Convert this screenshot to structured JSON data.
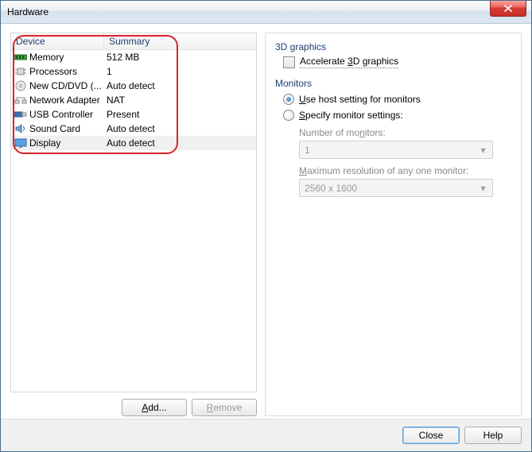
{
  "window": {
    "title": "Hardware"
  },
  "device_list": {
    "headers": {
      "device": "Device",
      "summary": "Summary"
    },
    "rows": [
      {
        "icon": "memory-icon",
        "name": "Memory",
        "summary": "512 MB",
        "selected": false
      },
      {
        "icon": "cpu-icon",
        "name": "Processors",
        "summary": "1",
        "selected": false
      },
      {
        "icon": "disc-icon",
        "name": "New CD/DVD (...",
        "summary": "Auto detect",
        "selected": false
      },
      {
        "icon": "network-icon",
        "name": "Network Adapter",
        "summary": "NAT",
        "selected": false
      },
      {
        "icon": "usb-icon",
        "name": "USB Controller",
        "summary": "Present",
        "selected": false
      },
      {
        "icon": "sound-icon",
        "name": "Sound Card",
        "summary": "Auto detect",
        "selected": false
      },
      {
        "icon": "display-icon",
        "name": "Display",
        "summary": "Auto detect",
        "selected": true
      }
    ]
  },
  "buttons": {
    "add": "Add...",
    "remove": "Remove",
    "close": "Close",
    "help": "Help"
  },
  "right": {
    "graphics_title": "3D graphics",
    "accelerate_pre": "Accelerate ",
    "accelerate_u": "3",
    "accelerate_post": "D graphics",
    "monitors_title": "Monitors",
    "use_host_pre": "",
    "use_host_u": "U",
    "use_host_post": "se host setting for monitors",
    "specify_pre": "",
    "specify_u": "S",
    "specify_post": "pecify monitor settings:",
    "num_monitors_pre": "Number of mo",
    "num_monitors_u": "n",
    "num_monitors_post": "itors:",
    "num_monitors_value": "1",
    "max_res_pre": "",
    "max_res_u": "M",
    "max_res_post": "aximum resolution of any one monitor:",
    "max_res_value": "2560 x 1600",
    "radio_selected": "use_host"
  }
}
